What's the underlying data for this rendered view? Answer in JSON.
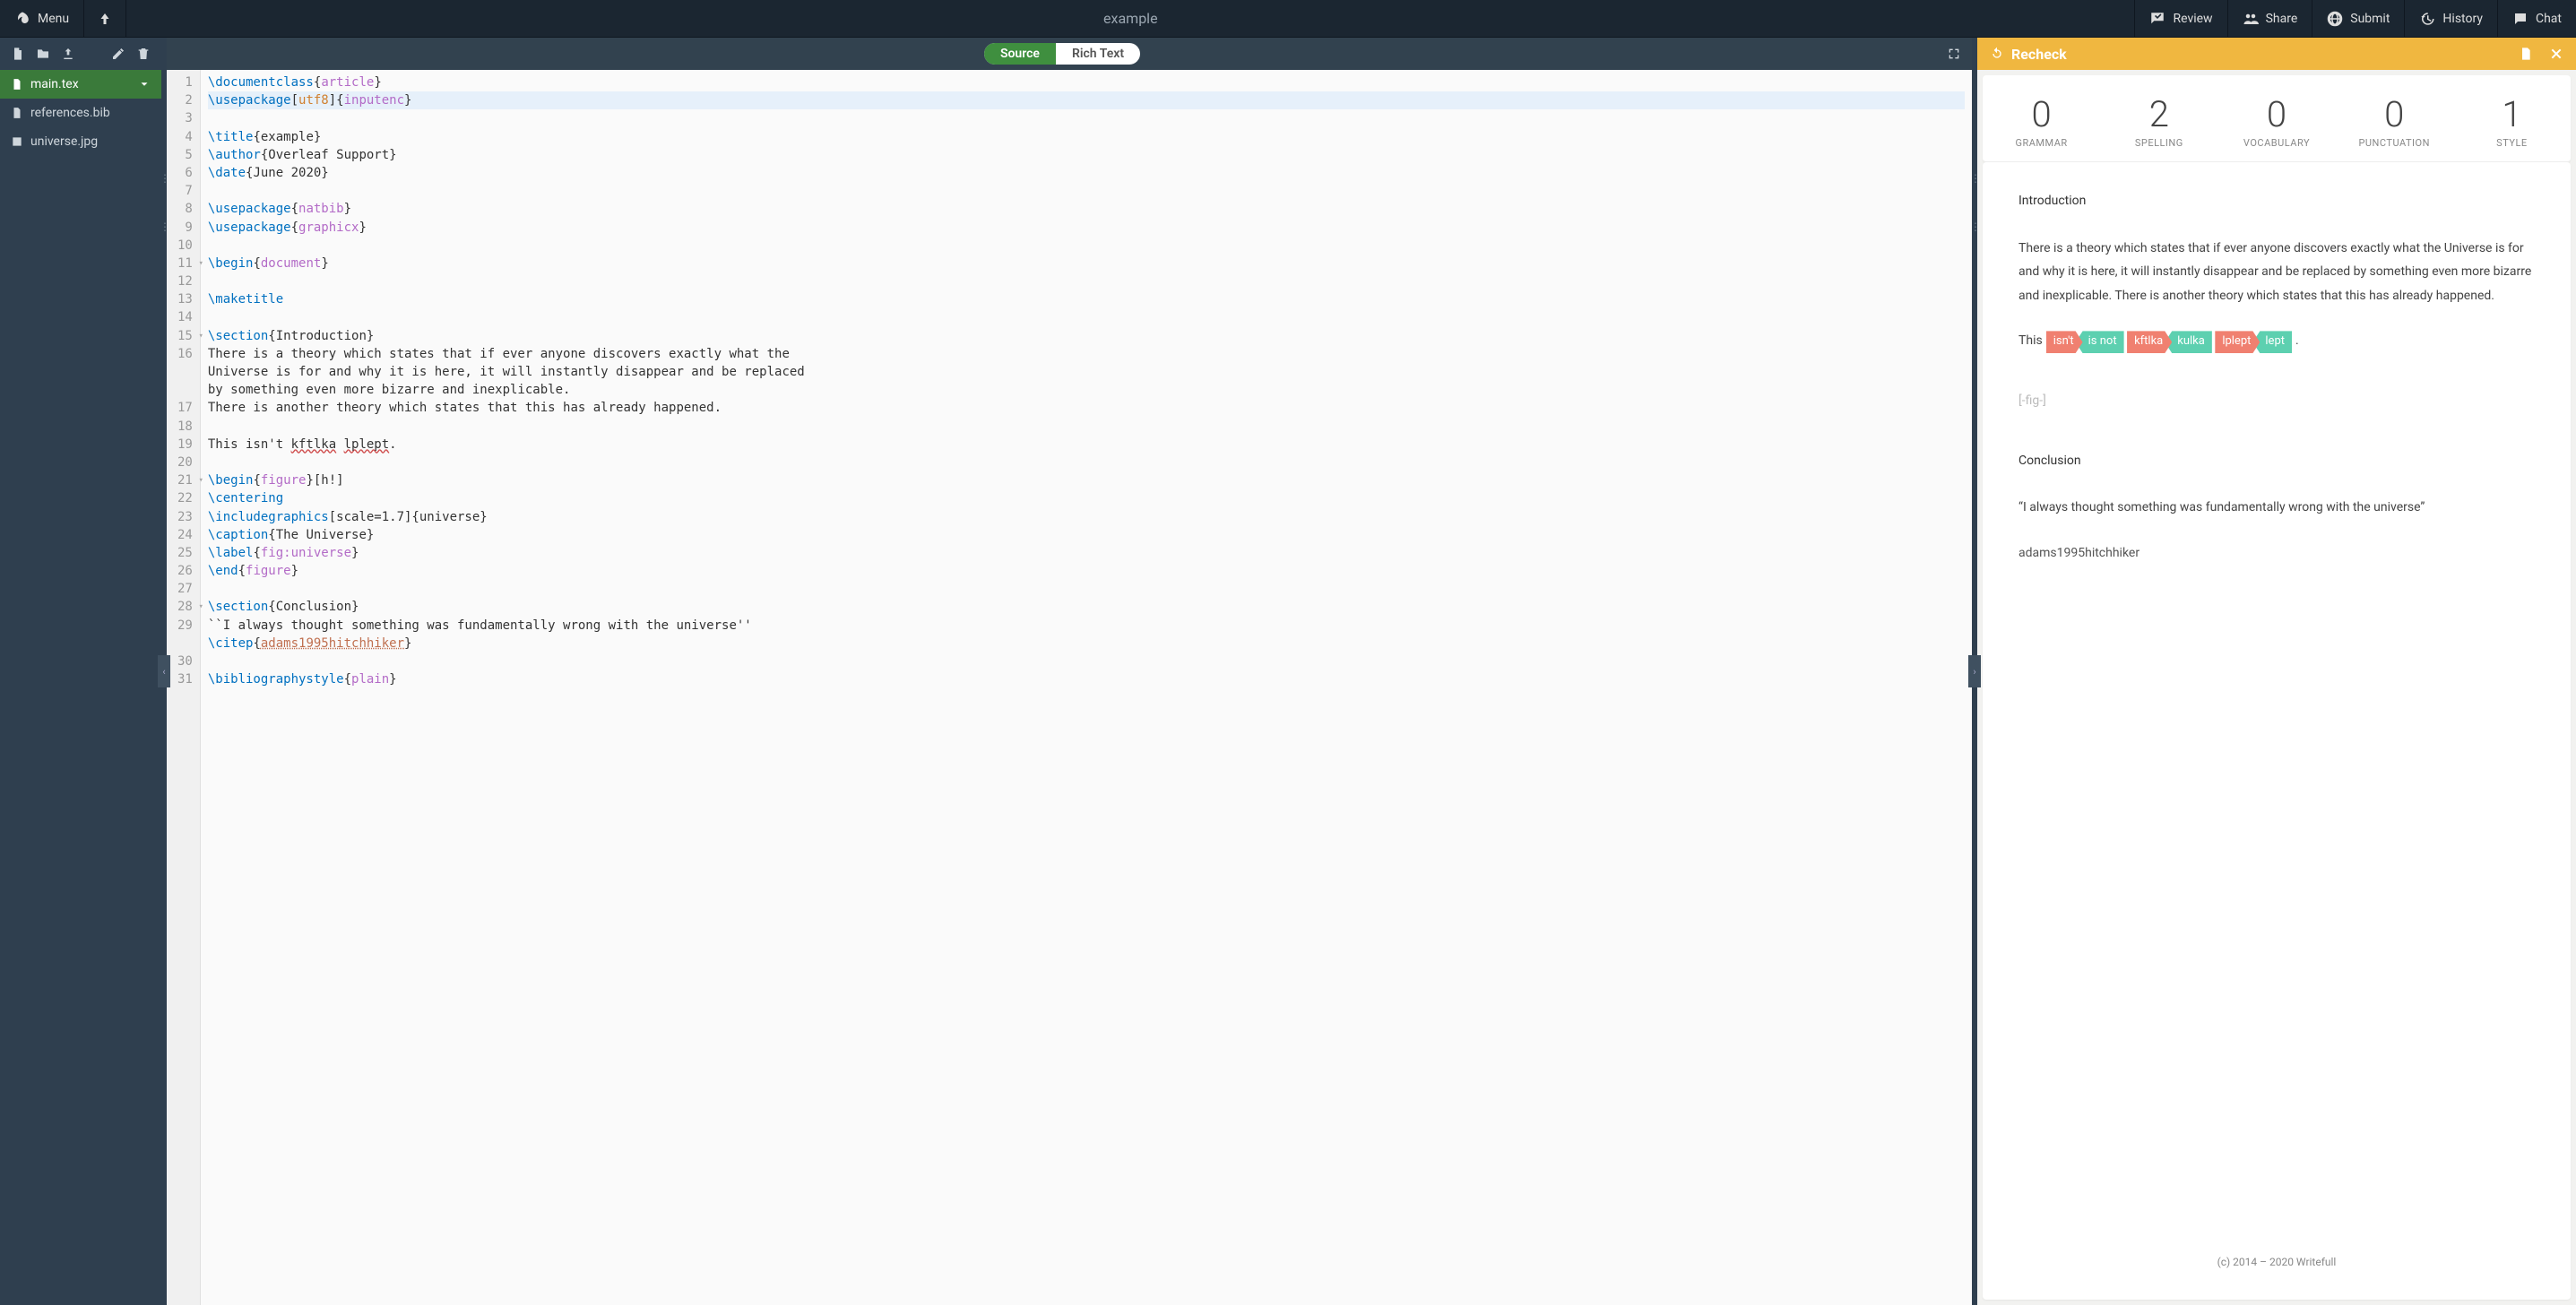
{
  "header": {
    "menu_label": "Menu",
    "title": "example",
    "review_label": "Review",
    "share_label": "Share",
    "submit_label": "Submit",
    "history_label": "History",
    "chat_label": "Chat"
  },
  "sidebar": {
    "files": [
      {
        "name": "main.tex",
        "icon": "file-icon",
        "active": true
      },
      {
        "name": "references.bib",
        "icon": "file-icon",
        "active": false
      },
      {
        "name": "universe.jpg",
        "icon": "image-icon",
        "active": false
      }
    ]
  },
  "editor": {
    "toggle": {
      "source": "Source",
      "richtext": "Rich Text"
    },
    "lines": [
      {
        "n": 1,
        "raw": "\\documentclass{article}",
        "tokens": [
          [
            "cmd",
            "\\documentclass"
          ],
          [
            "plain",
            "{"
          ],
          [
            "brace-content",
            "article"
          ],
          [
            "plain",
            "}"
          ]
        ]
      },
      {
        "n": 2,
        "hl": true,
        "raw": "\\usepackage[utf8]{inputenc}",
        "tokens": [
          [
            "cmd",
            "\\usepackage"
          ],
          [
            "plain",
            "["
          ],
          [
            "bracket-content",
            "utf8"
          ],
          [
            "plain",
            "]{"
          ],
          [
            "brace-content",
            "inputenc"
          ],
          [
            "plain",
            "}"
          ]
        ]
      },
      {
        "n": 3,
        "raw": "",
        "tokens": []
      },
      {
        "n": 4,
        "raw": "\\title{example}",
        "tokens": [
          [
            "cmd",
            "\\title"
          ],
          [
            "plain",
            "{example}"
          ]
        ]
      },
      {
        "n": 5,
        "raw": "\\author{Overleaf Support}",
        "tokens": [
          [
            "cmd",
            "\\author"
          ],
          [
            "plain",
            "{Overleaf Support}"
          ]
        ]
      },
      {
        "n": 6,
        "raw": "\\date{June 2020}",
        "tokens": [
          [
            "cmd",
            "\\date"
          ],
          [
            "plain",
            "{June 2020}"
          ]
        ]
      },
      {
        "n": 7,
        "raw": "",
        "tokens": []
      },
      {
        "n": 8,
        "raw": "\\usepackage{natbib}",
        "tokens": [
          [
            "cmd",
            "\\usepackage"
          ],
          [
            "plain",
            "{"
          ],
          [
            "brace-content",
            "natbib"
          ],
          [
            "plain",
            "}"
          ]
        ]
      },
      {
        "n": 9,
        "raw": "\\usepackage{graphicx}",
        "tokens": [
          [
            "cmd",
            "\\usepackage"
          ],
          [
            "plain",
            "{"
          ],
          [
            "brace-content",
            "graphicx"
          ],
          [
            "plain",
            "}"
          ]
        ]
      },
      {
        "n": 10,
        "raw": "",
        "tokens": []
      },
      {
        "n": 11,
        "fold": true,
        "raw": "\\begin{document}",
        "tokens": [
          [
            "cmd",
            "\\begin"
          ],
          [
            "plain",
            "{"
          ],
          [
            "brace-content",
            "document"
          ],
          [
            "plain",
            "}"
          ]
        ]
      },
      {
        "n": 12,
        "raw": "",
        "tokens": []
      },
      {
        "n": 13,
        "raw": "\\maketitle",
        "tokens": [
          [
            "cmd",
            "\\maketitle"
          ]
        ]
      },
      {
        "n": 14,
        "raw": "",
        "tokens": []
      },
      {
        "n": 15,
        "fold": true,
        "raw": "\\section{Introduction}",
        "tokens": [
          [
            "cmd",
            "\\section"
          ],
          [
            "plain",
            "{Introduction}"
          ]
        ]
      },
      {
        "n": 16,
        "raw": "There is a theory which states that if ever anyone discovers exactly what the Universe is for and why it is here, it will instantly disappear and be replaced by something even more bizarre and inexplicable.",
        "tokens": [
          [
            "plain",
            "There is a theory which states that if ever anyone discovers exactly what the "
          ]
        ],
        "wrap": [
          "Universe is for and why it is here, it will instantly disappear and be replaced ",
          "by something even more bizarre and inexplicable."
        ]
      },
      {
        "n": 17,
        "raw": "There is another theory which states that this has already happened.",
        "tokens": [
          [
            "plain",
            "There is another theory which states that this has already happened."
          ]
        ]
      },
      {
        "n": 18,
        "raw": "",
        "tokens": []
      },
      {
        "n": 19,
        "raw": "This isn't kftlka lplept.",
        "tokens": [
          [
            "plain",
            "This isn't "
          ],
          [
            "spellerr",
            "kftlka"
          ],
          [
            "plain",
            " "
          ],
          [
            "spellerr",
            "lplept"
          ],
          [
            "plain",
            "."
          ]
        ]
      },
      {
        "n": 20,
        "raw": "",
        "tokens": []
      },
      {
        "n": 21,
        "fold": true,
        "raw": "\\begin{figure}[h!]",
        "tokens": [
          [
            "cmd",
            "\\begin"
          ],
          [
            "plain",
            "{"
          ],
          [
            "brace-content",
            "figure"
          ],
          [
            "plain",
            "}[h!]"
          ]
        ]
      },
      {
        "n": 22,
        "raw": "\\centering",
        "tokens": [
          [
            "cmd",
            "\\centering"
          ]
        ]
      },
      {
        "n": 23,
        "raw": "\\includegraphics[scale=1.7]{universe}",
        "tokens": [
          [
            "cmd",
            "\\includegraphics"
          ],
          [
            "plain",
            "[scale=1.7]{universe}"
          ]
        ]
      },
      {
        "n": 24,
        "raw": "\\caption{The Universe}",
        "tokens": [
          [
            "cmd",
            "\\caption"
          ],
          [
            "plain",
            "{The Universe}"
          ]
        ]
      },
      {
        "n": 25,
        "raw": "\\label{fig:universe}",
        "tokens": [
          [
            "cmd",
            "\\label"
          ],
          [
            "plain",
            "{"
          ],
          [
            "brace-content",
            "fig:universe"
          ],
          [
            "plain",
            "}"
          ]
        ]
      },
      {
        "n": 26,
        "raw": "\\end{figure}",
        "tokens": [
          [
            "cmd",
            "\\end"
          ],
          [
            "plain",
            "{"
          ],
          [
            "brace-content",
            "figure"
          ],
          [
            "plain",
            "}"
          ]
        ]
      },
      {
        "n": 27,
        "raw": "",
        "tokens": []
      },
      {
        "n": 28,
        "fold": true,
        "raw": "\\section{Conclusion}",
        "tokens": [
          [
            "cmd",
            "\\section"
          ],
          [
            "plain",
            "{Conclusion}"
          ]
        ]
      },
      {
        "n": 29,
        "raw": "``I always thought something was fundamentally wrong with the universe''",
        "tokens": [
          [
            "plain",
            "``I always thought something was fundamentally wrong with the universe''"
          ]
        ],
        "wrap2": [
          [
            "cmd",
            "\\citep"
          ],
          [
            "plain",
            "{"
          ],
          [
            "cite-ref",
            "adams1995hitchhiker"
          ],
          [
            "plain",
            "}"
          ]
        ]
      },
      {
        "n": 30,
        "raw": "",
        "tokens": []
      },
      {
        "n": 31,
        "raw": "\\bibliographystyle{plain}",
        "tokens": [
          [
            "cmd",
            "\\bibliographystyle"
          ],
          [
            "plain",
            "{"
          ],
          [
            "brace-content",
            "plain"
          ],
          [
            "plain",
            "}"
          ]
        ]
      }
    ]
  },
  "right": {
    "recheck_label": "Recheck",
    "stats": [
      {
        "num": "0",
        "lbl": "GRAMMAR"
      },
      {
        "num": "2",
        "lbl": "SPELLING"
      },
      {
        "num": "0",
        "lbl": "VOCABULARY"
      },
      {
        "num": "0",
        "lbl": "PUNCTUATION"
      },
      {
        "num": "1",
        "lbl": "STYLE"
      }
    ],
    "intro_heading": "Introduction",
    "paragraph1": "There is a theory which states that if ever anyone discovers exactly what the Universe is for and why it is here, it will instantly disappear and be replaced by something even more bizarre and inexplicable. There is another theory which states that this has already happened.",
    "suggestion_prefix": "This ",
    "suggestions": [
      {
        "from": "isn't",
        "to": "is not"
      },
      {
        "from": "kftlka",
        "to": "kulka"
      },
      {
        "from": "lplept",
        "to": "lept"
      }
    ],
    "suggestion_suffix": " .",
    "fig_placeholder": "[-fig-]",
    "conclusion_heading": "Conclusion",
    "quote": "“I always thought something was fundamentally wrong with the universe”",
    "citation": "adams1995hitchhiker",
    "footer": "(c) 2014 – 2020 Writefull"
  }
}
